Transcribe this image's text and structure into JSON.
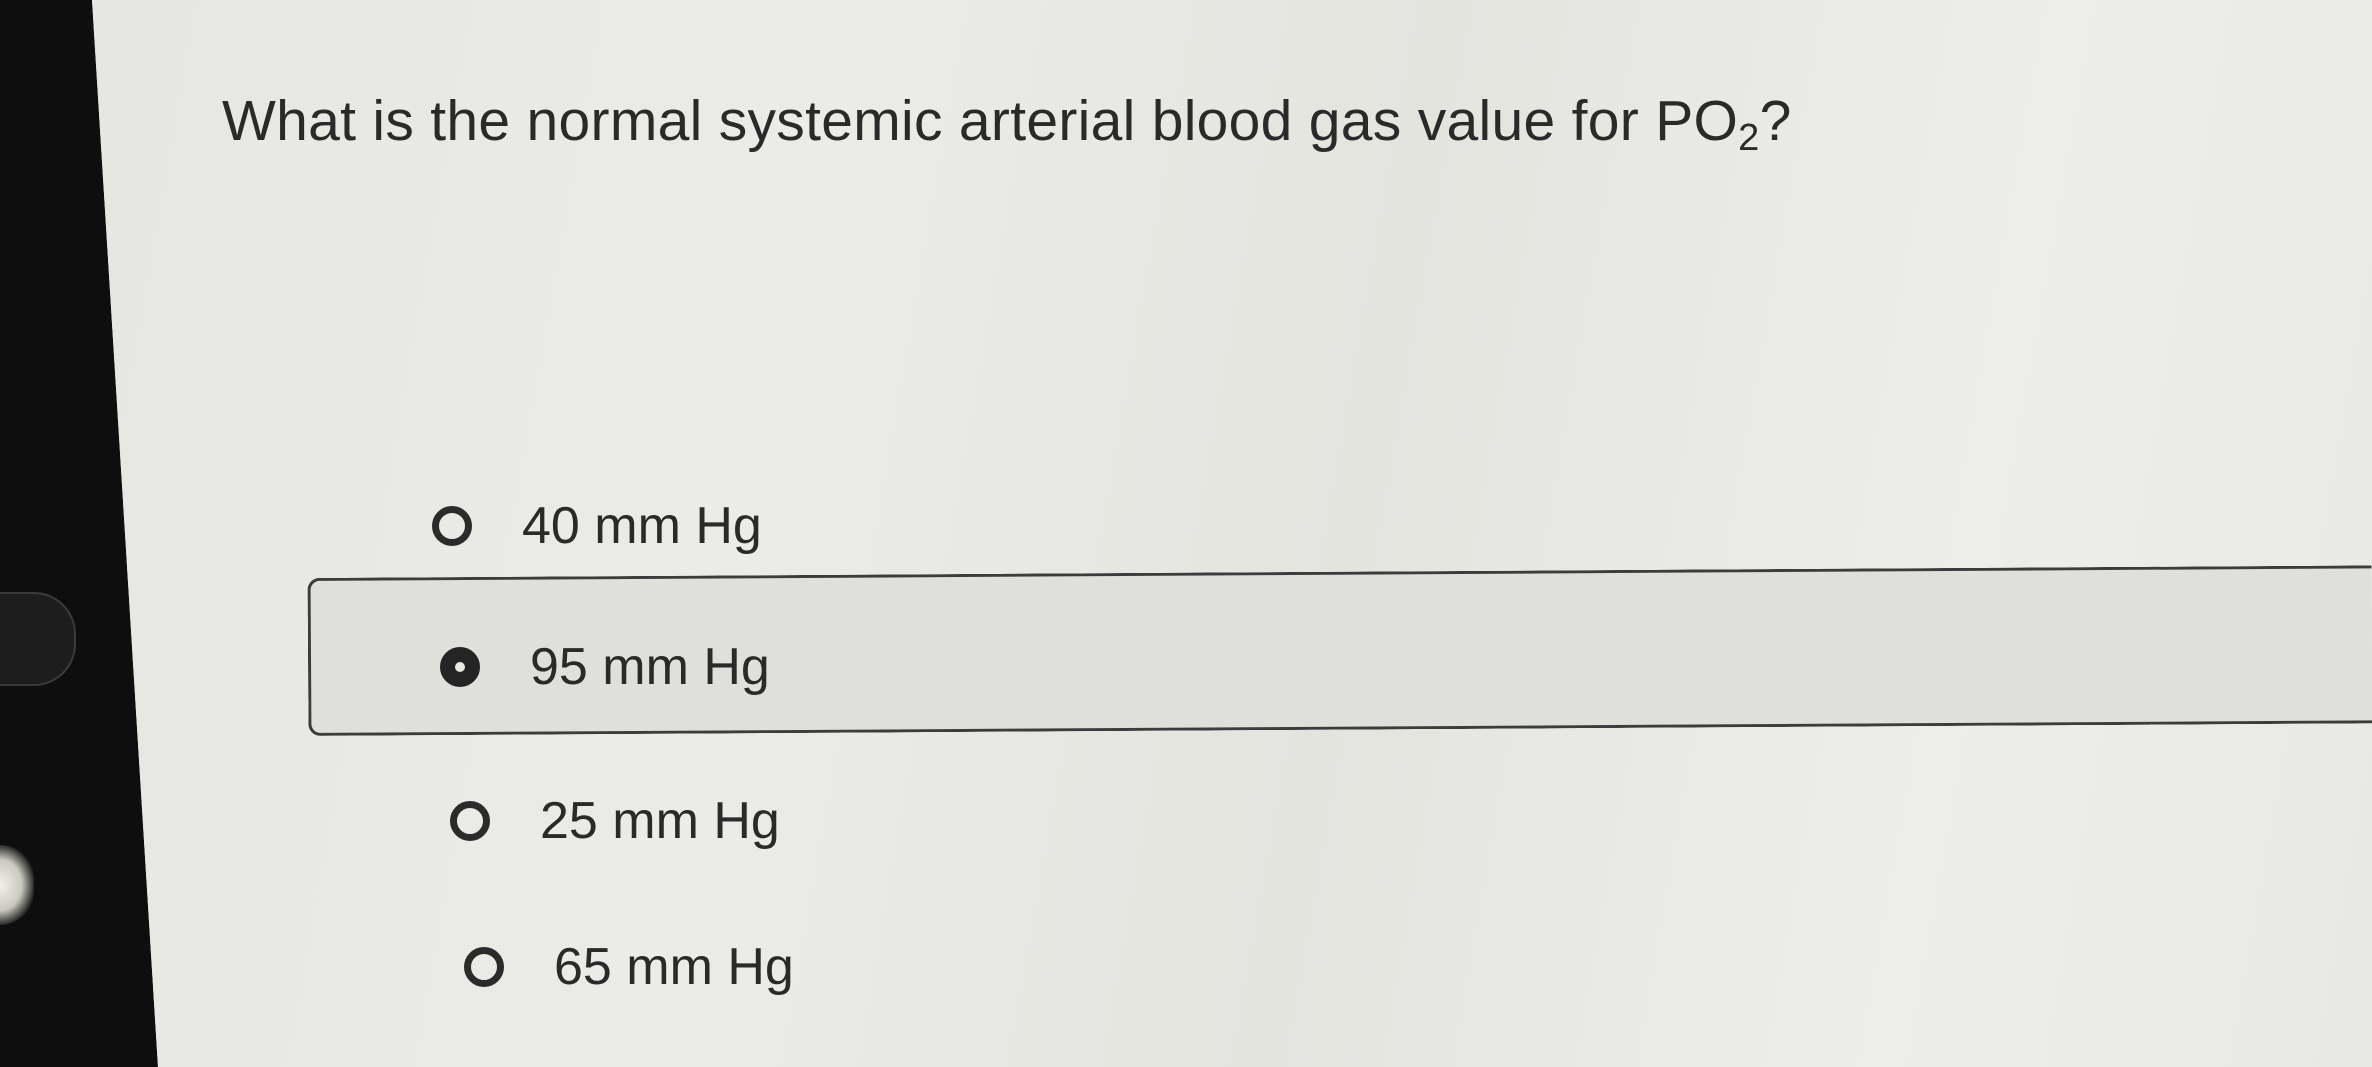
{
  "question": {
    "text": "What is the normal systemic arterial blood gas value for PO",
    "subscript": "2",
    "suffix": "?"
  },
  "options": [
    {
      "label": "40 mm Hg",
      "selected": false
    },
    {
      "label": "95 mm Hg",
      "selected": true
    },
    {
      "label": "25 mm Hg",
      "selected": false
    },
    {
      "label": "65 mm Hg",
      "selected": false
    }
  ],
  "colors": {
    "screen_background": "#ecece8",
    "selected_row_background": "#dfe0dc",
    "text": "#2a2a2a",
    "bezel": "#0e0e0e"
  },
  "icons": {
    "unselected": "radio-empty-icon",
    "selected": "radio-filled-icon"
  }
}
